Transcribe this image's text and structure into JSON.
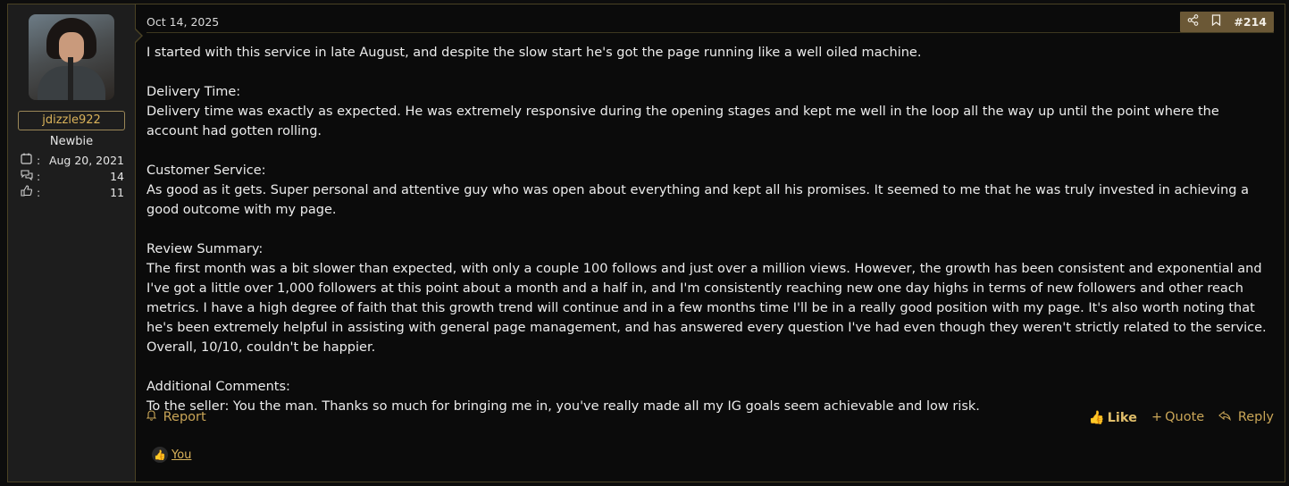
{
  "user": {
    "username": "jdizzle922",
    "title": "Newbie",
    "stats": [
      {
        "icon": "calendar-icon",
        "value": "Aug 20, 2021"
      },
      {
        "icon": "messages-icon",
        "value": "14"
      },
      {
        "icon": "thumbs-up-icon",
        "value": "11"
      }
    ],
    "colon": ":"
  },
  "post": {
    "date": "Oct 14, 2025",
    "number": "#214",
    "paragraphs": {
      "p1": "I started with this service in late August, and despite the slow start he's got the page running like a well oiled machine.",
      "h1": "Delivery Time:",
      "p2": "Delivery time was exactly as expected. He was extremely responsive during the opening stages and kept me well in the loop all the way up until the point where the account had gotten rolling.",
      "h2": "Customer Service:",
      "p3": "As good as it gets. Super personal and attentive guy who was open about everything and kept all his promises. It seemed to me that he was truly invested in achieving a good outcome with my page.",
      "h3": "Review Summary:",
      "p4": "The first month was a bit slower than expected, with only a couple 100 follows and just over a million views. However, the growth has been consistent and exponential and I've got a little over 1,000 followers at this point about a month and a half in, and I'm consistently reaching new one day highs in terms of new followers and other reach metrics. I have a high degree of faith that this growth trend will continue and in a few months time I'll be in a really good position with my page. It's also worth noting that he's been extremely helpful in assisting with general page management, and has answered every question I've had even though they weren't strictly related to the service. Overall, 10/10, couldn't be happier.",
      "h4": "Additional Comments:",
      "p5": "To the seller: You the man. Thanks so much for bringing me in, you've really made all my IG goals seem achievable and low risk."
    }
  },
  "footer": {
    "report": "Report",
    "like": "Like",
    "quote": "Quote",
    "reply": "Reply"
  },
  "reactions": {
    "by": "You"
  },
  "colors": {
    "accent": "#d9b25a",
    "toolbar": "#6b5836",
    "border": "#4a4224"
  }
}
